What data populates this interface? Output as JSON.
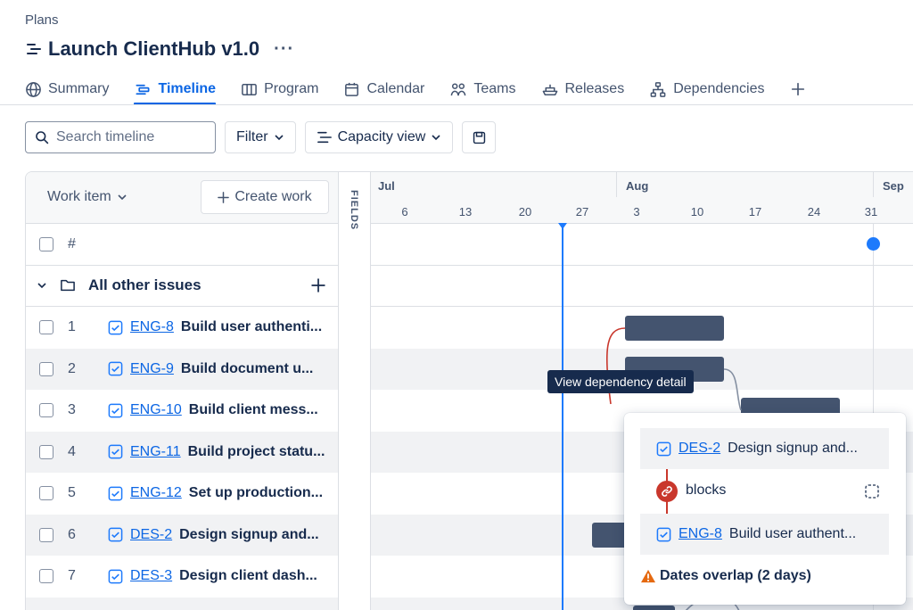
{
  "breadcrumb": "Plans",
  "plan": {
    "title": "Launch ClientHub v1.0",
    "more_label": "···"
  },
  "tabs": [
    {
      "label": "Summary",
      "icon": "globe-icon"
    },
    {
      "label": "Timeline",
      "icon": "timeline-icon",
      "active": true
    },
    {
      "label": "Program",
      "icon": "columns-icon"
    },
    {
      "label": "Calendar",
      "icon": "calendar-icon"
    },
    {
      "label": "Teams",
      "icon": "people-icon"
    },
    {
      "label": "Releases",
      "icon": "ship-icon"
    },
    {
      "label": "Dependencies",
      "icon": "hierarchy-icon"
    }
  ],
  "toolbar": {
    "search_placeholder": "Search timeline",
    "filter_label": "Filter",
    "capacity_label": "Capacity view"
  },
  "grid": {
    "work_item_header": "Work item",
    "create_work_label": "Create work",
    "fields_label": "FIELDS",
    "number_header": "#",
    "group_label": "All other issues",
    "months": [
      "Jul",
      "Aug",
      "Sep"
    ],
    "days": [
      "6",
      "13",
      "20",
      "27",
      "3",
      "10",
      "17",
      "24",
      "31"
    ],
    "rows": [
      {
        "num": "1",
        "key": "ENG-8",
        "summary": "Build user authenti..."
      },
      {
        "num": "2",
        "key": "ENG-9",
        "summary": "Build document u..."
      },
      {
        "num": "3",
        "key": "ENG-10",
        "summary": "Build client mess..."
      },
      {
        "num": "4",
        "key": "ENG-11",
        "summary": "Build project statu..."
      },
      {
        "num": "5",
        "key": "ENG-12",
        "summary": "Set up production..."
      },
      {
        "num": "6",
        "key": "DES-2",
        "summary": "Design signup and..."
      },
      {
        "num": "7",
        "key": "DES-3",
        "summary": "Design client dash..."
      }
    ]
  },
  "tooltip": "View dependency detail",
  "dependency_popup": {
    "from": {
      "key": "DES-2",
      "summary": "Design signup and..."
    },
    "relation": "blocks",
    "to": {
      "key": "ENG-8",
      "summary": "Build user authent..."
    },
    "warning": "Dates overlap (2 days)"
  },
  "colors": {
    "accent": "#0c66e4",
    "bar": "#44546f",
    "dependency_line_conflict": "#c9372c",
    "warning": "#e56910",
    "today_line": "#1d7afc"
  }
}
